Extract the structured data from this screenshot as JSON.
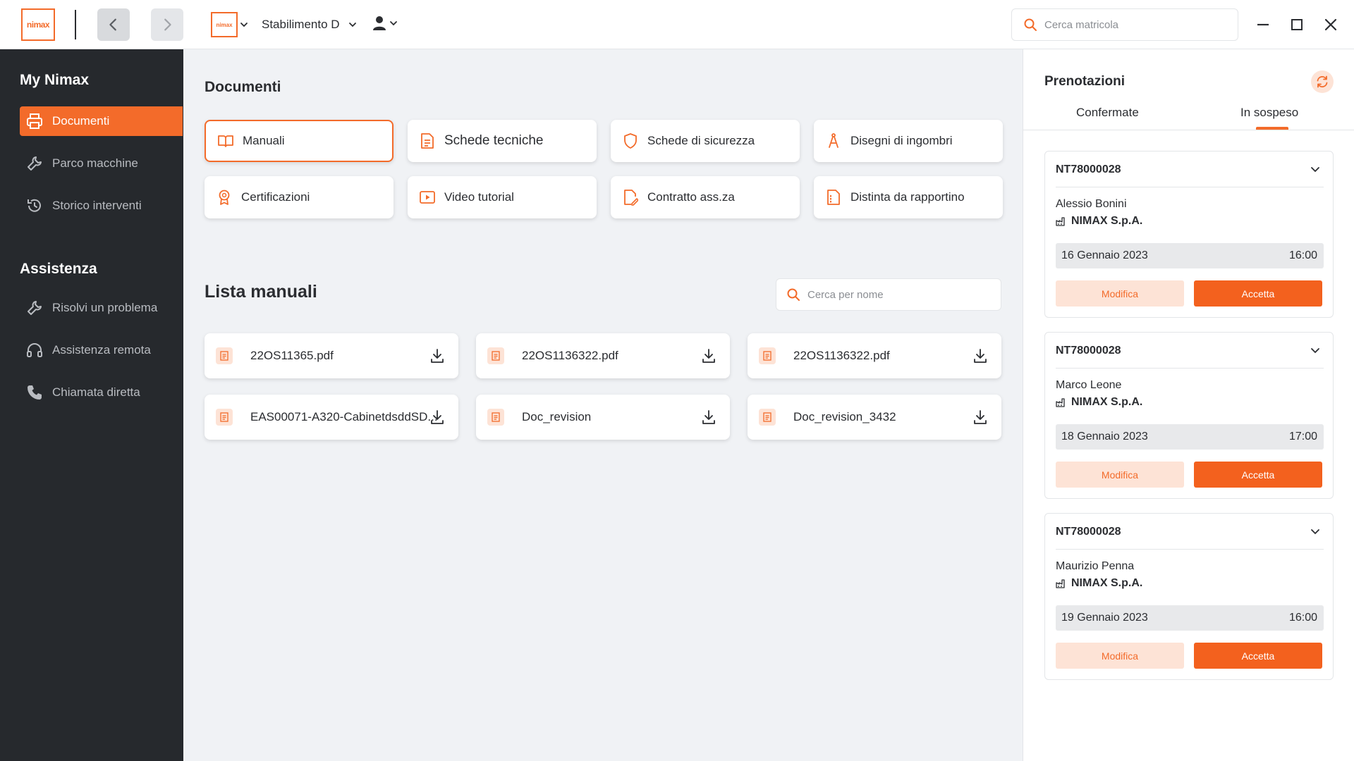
{
  "app": {
    "logo_text": "nimax",
    "plant_logo_text": "nimax",
    "plant_name": "Stabilimento D",
    "search_placeholder": "Cerca matricola"
  },
  "sidebar": {
    "section1_title": "My Nimax",
    "section1_items": [
      {
        "label": "Documenti",
        "icon": "printer-icon",
        "active": true
      },
      {
        "label": "Parco macchine",
        "icon": "wrench-icon"
      },
      {
        "label": "Storico interventi",
        "icon": "history-icon"
      }
    ],
    "section2_title": "Assistenza",
    "section2_items": [
      {
        "label": "Risolvi un problema",
        "icon": "wrench-icon"
      },
      {
        "label": "Assistenza remota",
        "icon": "headset-icon"
      },
      {
        "label": "Chiamata diretta",
        "icon": "phone-icon"
      }
    ]
  },
  "documents": {
    "title": "Documenti",
    "categories": [
      {
        "label": "Manuali",
        "icon": "book-icon",
        "active": true
      },
      {
        "label": "Schede tecniche",
        "icon": "document-icon"
      },
      {
        "label": "Schede di sicurezza",
        "icon": "shield-icon"
      },
      {
        "label": "Disegni di ingombri",
        "icon": "compass-icon"
      },
      {
        "label": "Certificazioni",
        "icon": "award-icon"
      },
      {
        "label": "Video tutorial",
        "icon": "video-icon"
      },
      {
        "label": "Contratto ass.za",
        "icon": "contract-icon"
      },
      {
        "label": "Distinta da rapportino",
        "icon": "list-document-icon"
      }
    ]
  },
  "manual_list": {
    "title": "Lista manuali",
    "search_placeholder": "Cerca per nome",
    "files": [
      "22OS11365.pdf",
      "22OS1136322.pdf",
      "22OS1136322.pdf",
      "EAS00071-A320-CabinetdsddSD...",
      "Doc_revision",
      "Doc_revision_3432"
    ]
  },
  "bookings": {
    "title": "Prenotazioni",
    "tabs": [
      "Confermate",
      "In sospeso"
    ],
    "active_tab": "In sospeso",
    "edit_label": "Modifica",
    "accept_label": "Accetta",
    "items": [
      {
        "code": "NT78000028",
        "person": "Alessio Bonini",
        "company": "NIMAX S.p.A.",
        "date": "16 Gennaio 2023",
        "time": "16:00"
      },
      {
        "code": "NT78000028",
        "person": "Marco Leone",
        "company": "NIMAX S.p.A.",
        "date": "18 Gennaio 2023",
        "time": "17:00"
      },
      {
        "code": "NT78000028",
        "person": "Maurizio Penna",
        "company": "NIMAX S.p.A.",
        "date": "19 Gennaio 2023",
        "time": "16:00"
      }
    ]
  },
  "colors": {
    "accent": "#f36b2a",
    "sidebar_bg": "#26292d",
    "main_bg": "#f0f2f5"
  }
}
